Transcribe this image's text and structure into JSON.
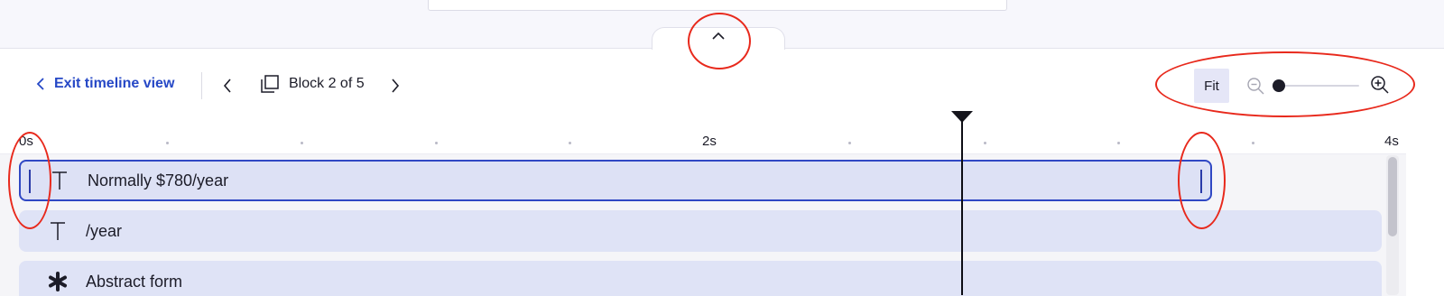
{
  "toolbar": {
    "exit_label": "Exit timeline view",
    "block_indicator": "Block 2 of 5",
    "fit_label": "Fit",
    "zoom_level": 0.0
  },
  "ruler": {
    "labels": [
      "0s",
      "2s",
      "4s"
    ]
  },
  "tracks": [
    {
      "label": "Normally $780/year",
      "icon": "text-icon",
      "selected": true
    },
    {
      "label": "/year",
      "icon": "text-icon",
      "selected": false
    },
    {
      "label": "Abstract form",
      "icon": "asterisk-shape-icon",
      "selected": false
    }
  ],
  "playhead_time_s": 2.78,
  "colors": {
    "accent": "#2648c6",
    "track_fill": "#dfe3f6",
    "fit_bg": "#e5e6f7",
    "annotation": "#e8291c"
  }
}
